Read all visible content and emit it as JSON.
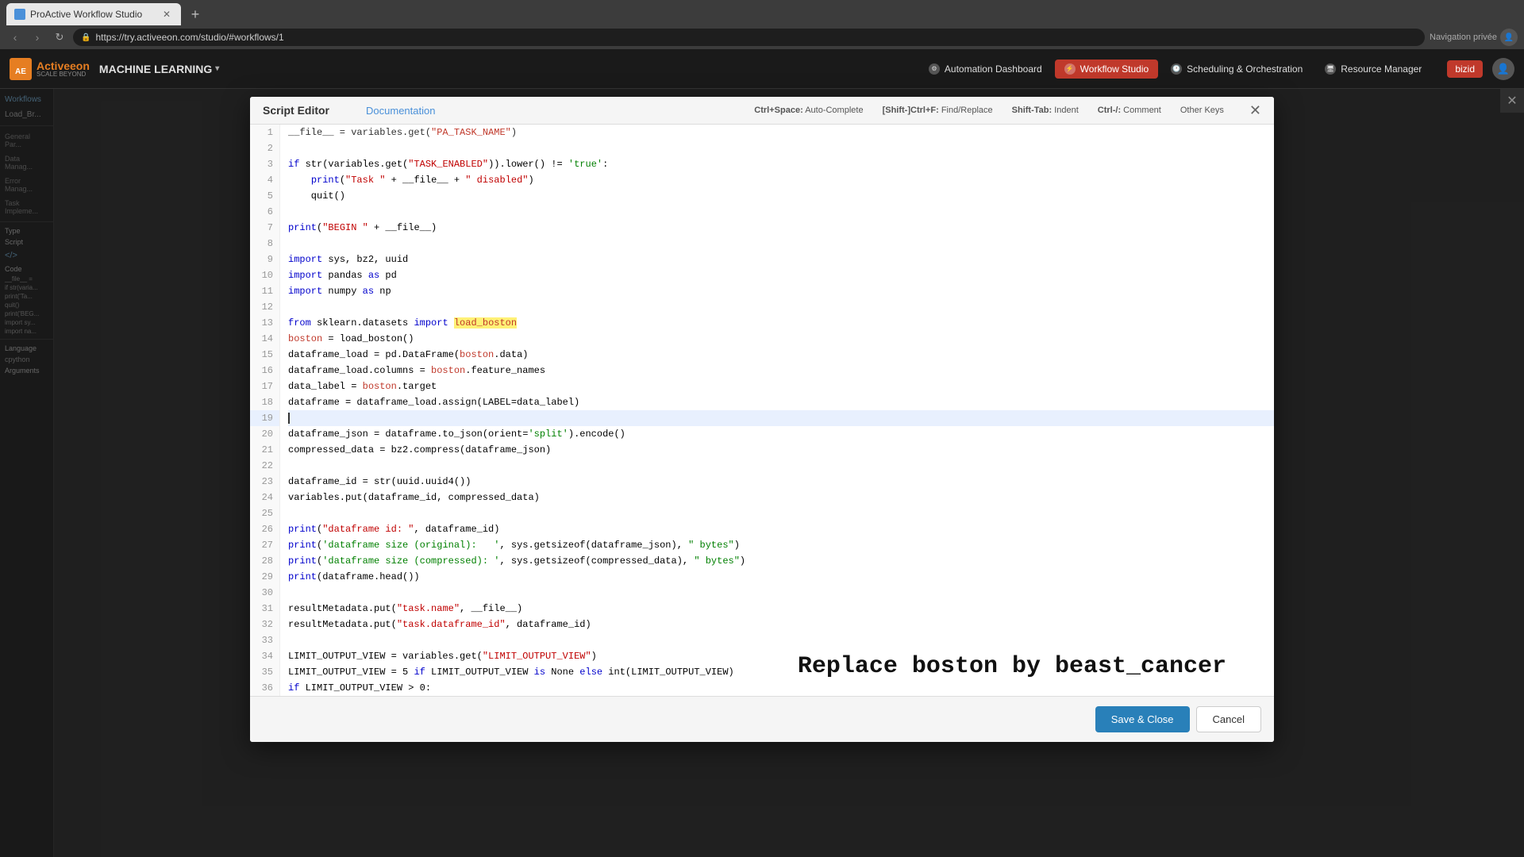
{
  "browser": {
    "tab_title": "ProActive Workflow Studio",
    "url": "https://try.activeeon.com/studio/#workflows/1",
    "new_tab_label": "+",
    "nav_private": "Navigation privée"
  },
  "header": {
    "logo_text": "Activeeon",
    "logo_sub": "SCALE BEYOND",
    "section": "MACHINE LEARNING",
    "nav_items": [
      {
        "id": "automation",
        "label": "Automation Dashboard",
        "active": false
      },
      {
        "id": "workflow",
        "label": "Workflow Studio",
        "active": true
      },
      {
        "id": "scheduling",
        "label": "Scheduling & Orchestration",
        "active": false
      },
      {
        "id": "resource",
        "label": "Resource Manager",
        "active": false
      }
    ],
    "user": "bizid"
  },
  "sidebar": {
    "items": [
      {
        "id": "workflows",
        "label": "Workflows"
      },
      {
        "id": "load_br",
        "label": "Load_Br..."
      }
    ],
    "sections": [
      "General Par...",
      "Data Manag...",
      "Error Manag...",
      "Task Impleme..."
    ]
  },
  "modal": {
    "title": "Script Editor",
    "doc_link": "Documentation",
    "shortcuts": [
      {
        "keys": "Ctrl+Space:",
        "action": "Auto-Complete"
      },
      {
        "keys": "[Shift-]Ctrl+F:",
        "action": "Find/Replace"
      },
      {
        "keys": "Shift-Tab:",
        "action": "Indent"
      },
      {
        "keys": "Ctrl-/:",
        "action": "Comment"
      },
      {
        "keys": "Other Keys",
        "action": ""
      }
    ],
    "save_close_label": "Save & Close",
    "cancel_label": "Cancel"
  },
  "code": {
    "lines": [
      {
        "num": 1,
        "content": "__file__ = variables.get(\"PA_TASK_NAME\")"
      },
      {
        "num": 2,
        "content": ""
      },
      {
        "num": 3,
        "content": "if str(variables.get(\"TASK_ENABLED\")).lower() != 'true':"
      },
      {
        "num": 4,
        "content": "    print(\"Task \" + __file__ + \" disabled\")"
      },
      {
        "num": 5,
        "content": "    quit()"
      },
      {
        "num": 6,
        "content": ""
      },
      {
        "num": 7,
        "content": "print(\"BEGIN \" + __file__)"
      },
      {
        "num": 8,
        "content": ""
      },
      {
        "num": 9,
        "content": "import sys, bz2, uuid"
      },
      {
        "num": 10,
        "content": "import pandas as pd"
      },
      {
        "num": 11,
        "content": "import numpy as np"
      },
      {
        "num": 12,
        "content": ""
      },
      {
        "num": 13,
        "content": "from sklearn.datasets import load_boston"
      },
      {
        "num": 14,
        "content": "boston = load_boston()"
      },
      {
        "num": 15,
        "content": "dataframe_load = pd.DataFrame(boston.data)"
      },
      {
        "num": 16,
        "content": "dataframe_load.columns = boston.feature_names"
      },
      {
        "num": 17,
        "content": "data_label = boston.target"
      },
      {
        "num": 18,
        "content": "dataframe = dataframe_load.assign(LABEL=data_label)"
      },
      {
        "num": 19,
        "content": ""
      },
      {
        "num": 20,
        "content": "dataframe_json = dataframe.to_json(orient='split').encode()"
      },
      {
        "num": 21,
        "content": "compressed_data = bz2.compress(dataframe_json)"
      },
      {
        "num": 22,
        "content": ""
      },
      {
        "num": 23,
        "content": "dataframe_id = str(uuid.uuid4())"
      },
      {
        "num": 24,
        "content": "variables.put(dataframe_id, compressed_data)"
      },
      {
        "num": 25,
        "content": ""
      },
      {
        "num": 26,
        "content": "print(\"dataframe id: \", dataframe_id)"
      },
      {
        "num": 27,
        "content": "print('dataframe size (original):   ', sys.getsizeof(dataframe_json), \" bytes\")"
      },
      {
        "num": 28,
        "content": "print('dataframe size (compressed): ', sys.getsizeof(compressed_data), \" bytes\")"
      },
      {
        "num": 29,
        "content": "print(dataframe.head())"
      },
      {
        "num": 30,
        "content": ""
      },
      {
        "num": 31,
        "content": "resultMetadata.put(\"task.name\", __file__)"
      },
      {
        "num": 32,
        "content": "resultMetadata.put(\"task.dataframe_id\", dataframe_id)"
      },
      {
        "num": 33,
        "content": ""
      },
      {
        "num": 34,
        "content": "LIMIT_OUTPUT_VIEW = variables.get(\"LIMIT_OUTPUT_VIEW\")"
      },
      {
        "num": 35,
        "content": "LIMIT_OUTPUT_VIEW = 5 if LIMIT_OUTPUT_VIEW is None else int(LIMIT_OUTPUT_VIEW)"
      },
      {
        "num": 36,
        "content": "if LIMIT_OUTPUT_VIEW > 0:"
      }
    ]
  },
  "annotation": {
    "text": "Replace boston by beast_cancer"
  },
  "left_panel": {
    "type_label": "Type",
    "script_label": "Script",
    "code_label": "Code",
    "file_label": "__file__ =",
    "condition_label": "if str(varia...",
    "print1_label": "print('Ta...",
    "quit_label": "quit()",
    "print2_label": "print('BEG...",
    "import1_label": "import sy...",
    "import2_label": "import na...",
    "language_label": "Language",
    "cpython_label": "cpython",
    "arguments_label": "Arguments"
  }
}
